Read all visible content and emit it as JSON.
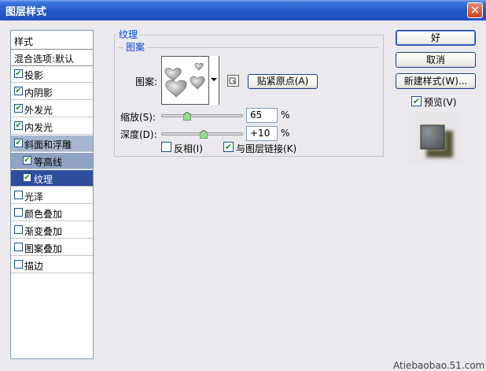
{
  "window": {
    "title": "图层样式",
    "close_glyph": "✕"
  },
  "left_panel": {
    "header": "样式",
    "blend_options": "混合选项:默认",
    "items": [
      {
        "label": "投影",
        "checked": true
      },
      {
        "label": "内阴影",
        "checked": true
      },
      {
        "label": "外发光",
        "checked": true
      },
      {
        "label": "内发光",
        "checked": true
      },
      {
        "label": "斜面和浮雕",
        "checked": true
      },
      {
        "label": "等高线",
        "checked": true
      },
      {
        "label": "纹理",
        "checked": true
      },
      {
        "label": "光泽",
        "checked": false
      },
      {
        "label": "颜色叠加",
        "checked": false
      },
      {
        "label": "渐变叠加",
        "checked": false
      },
      {
        "label": "图案叠加",
        "checked": false
      },
      {
        "label": "描边",
        "checked": false
      }
    ]
  },
  "texture_panel": {
    "group_title": "纹理",
    "subgroup_title": "图案",
    "pattern_label": "图案:",
    "snap_button": "贴紧原点(A)",
    "scale_label": "缩放(S):",
    "scale_value": "65",
    "scale_unit": "%",
    "depth_label": "深度(D):",
    "depth_value": "+10",
    "depth_unit": "%",
    "invert_label": "反相(I)",
    "invert_checked": false,
    "link_label": "与图层链接(K)",
    "link_checked": true,
    "scale_fraction": 0.32,
    "depth_fraction": 0.52
  },
  "right_buttons": {
    "ok": "好",
    "cancel": "取消",
    "new_style": "新建样式(W)...",
    "preview_label": "预览(V)",
    "preview_checked": true
  },
  "watermark": "Atiebaobao.51.com",
  "check_glyph": "✔",
  "colors": {
    "title_bar": "#2458c8",
    "selected_item": "#2e4d9b",
    "check": "#218c21",
    "group_title": "#0046d5"
  }
}
